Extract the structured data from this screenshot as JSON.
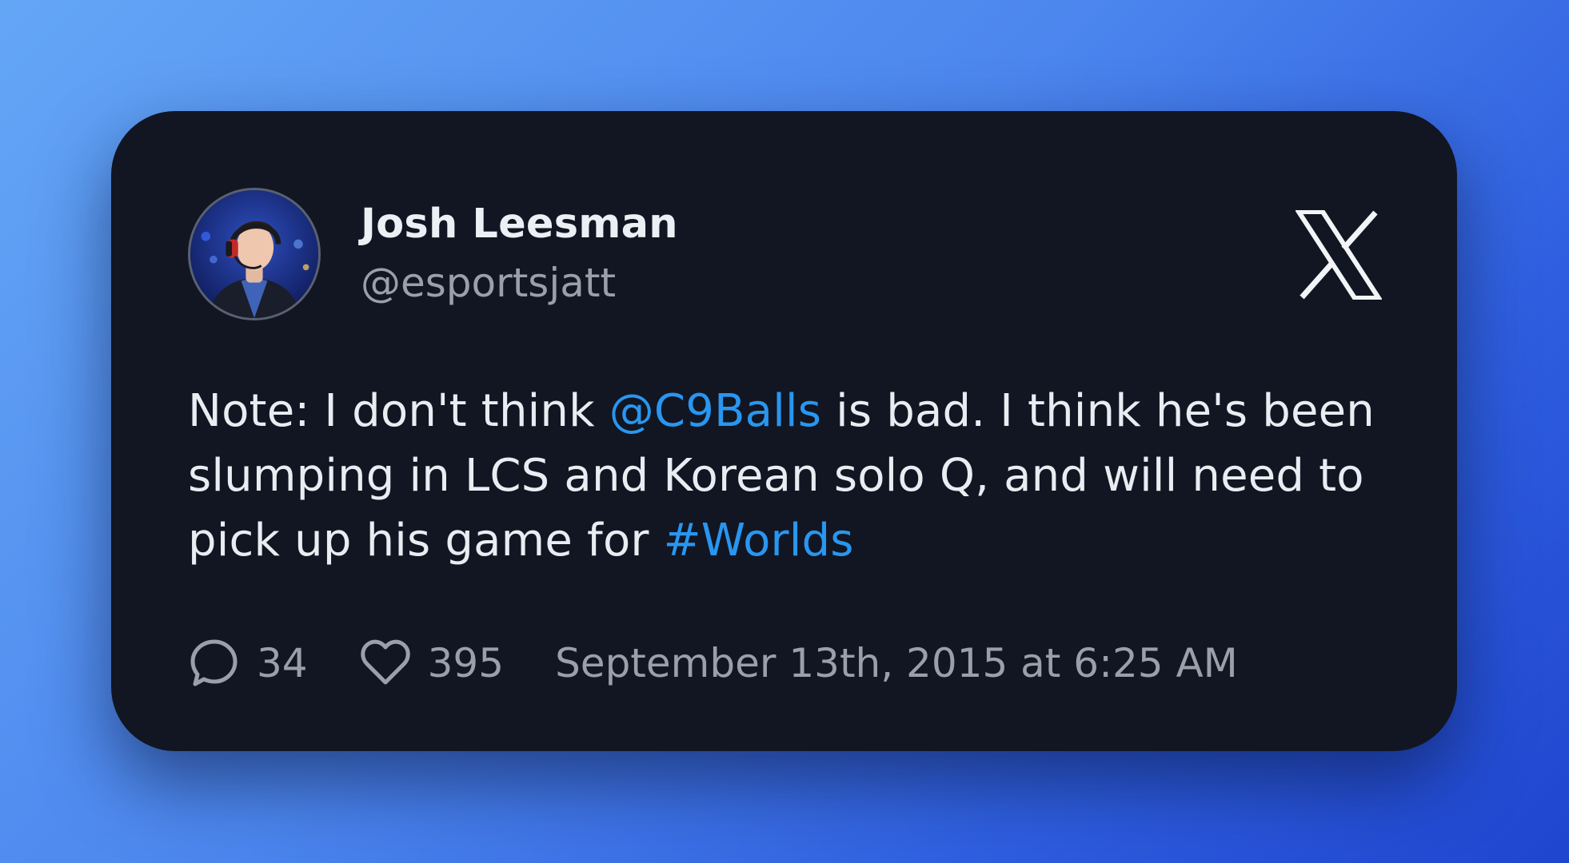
{
  "tweet": {
    "author": {
      "name": "Josh Leesman",
      "handle": "@esportsjatt",
      "avatar_icon": "profile-photo"
    },
    "platform_icon": "x-logo-icon",
    "text": {
      "part1": "Note: I don't think ",
      "mention": "@C9Balls",
      "part2": " is bad. I think he's been slumping in LCS and Korean solo Q, and will need to pick up his game for ",
      "hashtag": "#Worlds"
    },
    "stats": {
      "replies": "34",
      "likes": "395"
    },
    "timestamp": "September 13th, 2015 at 6:25 AM"
  },
  "colors": {
    "card_background": "#111622",
    "link": "#2996f0",
    "primary_text": "#e9ecf1",
    "secondary_text": "#9aa0aa"
  }
}
